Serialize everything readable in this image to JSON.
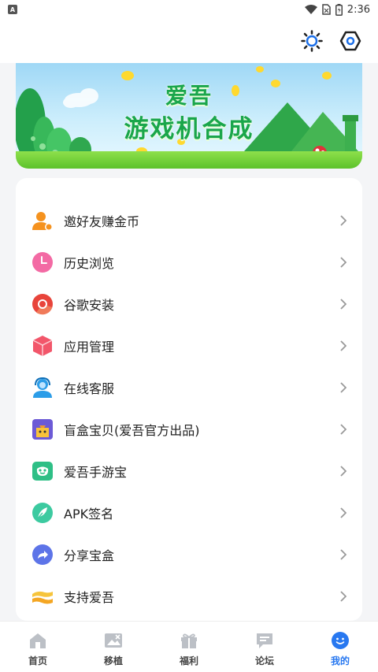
{
  "status_bar": {
    "time": "2:36"
  },
  "banner": {
    "line1": "爱吾",
    "line2": "游戏机合成"
  },
  "menu": [
    {
      "label": "邀好友赚金币",
      "icon": "invite-user-icon"
    },
    {
      "label": "历史浏览",
      "icon": "history-clock-icon"
    },
    {
      "label": "谷歌安装",
      "icon": "google-chrome-icon"
    },
    {
      "label": "应用管理",
      "icon": "app-box-icon"
    },
    {
      "label": "在线客服",
      "icon": "customer-service-icon"
    },
    {
      "label": "盲盒宝贝(爱吾官方出品)",
      "icon": "blind-box-icon"
    },
    {
      "label": "爱吾手游宝",
      "icon": "game-assistant-icon"
    },
    {
      "label": "APK签名",
      "icon": "feather-sign-icon"
    },
    {
      "label": "分享宝盒",
      "icon": "share-icon"
    },
    {
      "label": "支持爱吾",
      "icon": "support-hands-icon"
    }
  ],
  "tabs": [
    {
      "label": "首页",
      "icon": "home-icon"
    },
    {
      "label": "移植",
      "icon": "port-image-icon"
    },
    {
      "label": "福利",
      "icon": "gift-icon"
    },
    {
      "label": "论坛",
      "icon": "forum-icon"
    },
    {
      "label": "我的",
      "icon": "profile-icon",
      "active": true
    }
  ],
  "colors": {
    "accent": "#2878f0",
    "background": "#f4f5f7"
  }
}
